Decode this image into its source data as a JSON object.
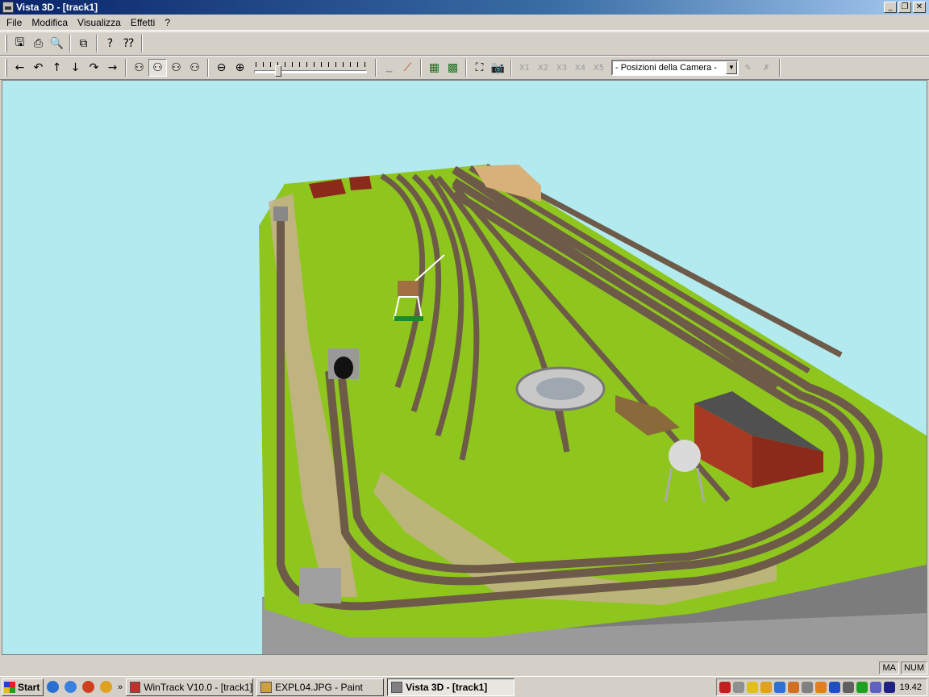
{
  "window": {
    "title": "Vista 3D - [track1]"
  },
  "window_buttons": {
    "minimize": "_",
    "restore": "❐",
    "close": "✕"
  },
  "menu": [
    {
      "label": "File"
    },
    {
      "label": "Modifica"
    },
    {
      "label": "Visualizza"
    },
    {
      "label": "Effetti"
    },
    {
      "label": "?"
    }
  ],
  "toolbar1": [
    {
      "name": "save-icon",
      "glyph": "🖫"
    },
    {
      "name": "print-icon",
      "glyph": "⎙"
    },
    {
      "name": "print-preview-icon",
      "glyph": "🔍"
    },
    {
      "name": "copy-icon",
      "glyph": "⧉"
    },
    {
      "name": "help-icon",
      "glyph": "?"
    },
    {
      "name": "context-help-icon",
      "glyph": "⁇"
    }
  ],
  "toolbar2": {
    "nav": [
      {
        "name": "arrow-left-icon",
        "glyph": "←"
      },
      {
        "name": "turn-left-icon",
        "glyph": "↶"
      },
      {
        "name": "arrow-up-icon",
        "glyph": "↑"
      },
      {
        "name": "arrow-down-icon",
        "glyph": "↓"
      },
      {
        "name": "turn-right-icon",
        "glyph": "↷"
      },
      {
        "name": "arrow-right-icon",
        "glyph": "→"
      }
    ],
    "view": [
      {
        "name": "walk-view-icon",
        "glyph": "⚇",
        "pressed": false
      },
      {
        "name": "fly-view-icon",
        "glyph": "⚇",
        "pressed": true
      },
      {
        "name": "tilt-view-icon",
        "glyph": "⚇",
        "pressed": false
      },
      {
        "name": "orbit-view-icon",
        "glyph": "⚇",
        "pressed": false
      }
    ],
    "zoom": [
      {
        "name": "zoom-out-icon",
        "glyph": "⊖"
      },
      {
        "name": "zoom-in-icon",
        "glyph": "⊕"
      }
    ],
    "zoom_level": 0.2,
    "scene": [
      {
        "name": "terrain-icon",
        "glyph": "▁",
        "dim": true
      },
      {
        "name": "signal-icon",
        "glyph": "⟋",
        "dim": false
      },
      {
        "name": "texture-icon",
        "glyph": "▦",
        "dim": false
      },
      {
        "name": "grid-icon",
        "glyph": "▩",
        "dim": false
      },
      {
        "name": "fit-view-icon",
        "glyph": "⛶",
        "dim": false
      },
      {
        "name": "camera-icon",
        "glyph": "📷",
        "dim": false
      }
    ],
    "cameras": [
      {
        "name": "camera-slot-1",
        "label": "X1"
      },
      {
        "name": "camera-slot-2",
        "label": "X2"
      },
      {
        "name": "camera-slot-3",
        "label": "X3"
      },
      {
        "name": "camera-slot-4",
        "label": "X4"
      },
      {
        "name": "camera-slot-5",
        "label": "X5"
      }
    ],
    "camera_select": "- Posizioni della Camera -",
    "camera_edit": [
      {
        "name": "camera-add-icon",
        "glyph": "✎"
      },
      {
        "name": "camera-delete-icon",
        "glyph": "✗"
      }
    ]
  },
  "status": {
    "caps": "MA",
    "num": "NUM"
  },
  "taskbar": {
    "start": "Start",
    "tasks": [
      {
        "label": "WinTrack  V10.0 - [track1]",
        "active": false,
        "color": "#c03030"
      },
      {
        "label": "EXPL04.JPG - Paint",
        "active": false,
        "color": "#d0a040"
      },
      {
        "label": "Vista 3D - [track1]",
        "active": true,
        "color": "#808080"
      }
    ],
    "quicklaunch": [
      "#2a70d0",
      "#3a80e0",
      "#d04020",
      "#e0a020"
    ],
    "tray_colors": [
      "#c02020",
      "#909090",
      "#e0c020",
      "#e0a020",
      "#3070d0",
      "#d07020",
      "#808080",
      "#e08020",
      "#2050c0",
      "#606060",
      "#20a020",
      "#6060c0",
      "#202080"
    ],
    "clock": "19.42"
  },
  "colors": {
    "sky": "#b3eaef",
    "grass": "#8ec61e",
    "track": "#6e5a48",
    "building": "#8b2a1a"
  }
}
